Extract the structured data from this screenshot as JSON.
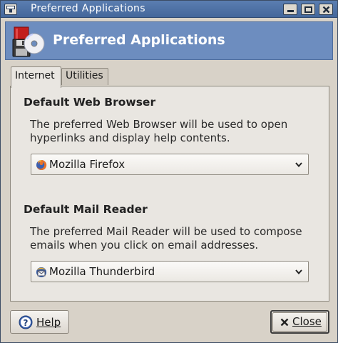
{
  "window": {
    "title": "Preferred Applications",
    "controls": [
      "minimize-icon",
      "maximize-icon",
      "close-icon"
    ]
  },
  "banner": {
    "title": "Preferred Applications",
    "icon": "preferred-apps-icon"
  },
  "tabs": [
    {
      "label": "Internet",
      "active": true
    },
    {
      "label": "Utilities",
      "active": false
    }
  ],
  "internet": {
    "browser_section": {
      "title": "Default Web Browser",
      "description": "The preferred Web Browser will be used to open hyperlinks and display help contents.",
      "selected": "Mozilla Firefox",
      "icon": "firefox-icon"
    },
    "mail_section": {
      "title": "Default Mail Reader",
      "description": "The preferred Mail Reader will be used to compose emails when you click on email addresses.",
      "selected": "Mozilla Thunderbird",
      "icon": "thunderbird-icon"
    }
  },
  "buttons": {
    "help": "Help",
    "close": "Close"
  },
  "colors": {
    "titlebar": "#4f72a6",
    "banner": "#6d8dbf",
    "panel": "#e9e6e1",
    "window_bg": "#d8d2c8"
  }
}
